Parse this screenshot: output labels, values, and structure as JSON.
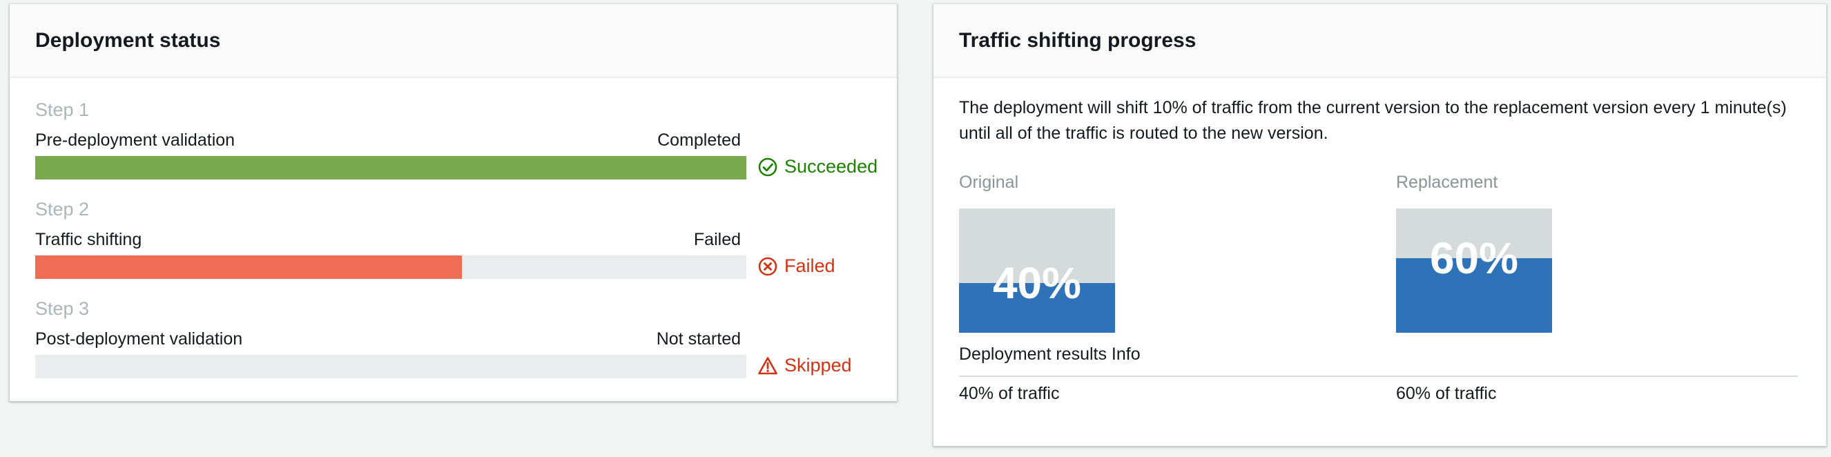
{
  "deployment": {
    "title": "Deployment status",
    "steps": [
      {
        "step": "Step 1",
        "name": "Pre-deployment validation",
        "state": "Completed",
        "progress": 1.0,
        "bar_color": "#7aa94d",
        "result": "Succeeded",
        "result_color": "#1d8102",
        "icon": "check-circle-icon"
      },
      {
        "step": "Step 2",
        "name": "Traffic shifting",
        "state": "Failed",
        "progress": 0.6,
        "bar_color": "#f06d55",
        "result": "Failed",
        "result_color": "#d13212",
        "icon": "x-circle-icon"
      },
      {
        "step": "Step 3",
        "name": "Post-deployment validation",
        "state": "Not started",
        "progress": 0.0,
        "bar_color": "#eaeded",
        "result": "Skipped",
        "result_color": "#d13212",
        "icon": "warning-icon"
      }
    ]
  },
  "traffic": {
    "title": "Traffic shifting progress",
    "description": "The deployment will shift 10% of traffic from the current version to the replacement version every 1 minute(s) until all of the traffic is routed to the new version.",
    "original": {
      "label": "Original",
      "percent_text": "40%",
      "fill": 0.4
    },
    "replacement": {
      "label": "Replacement",
      "percent_text": "60%",
      "fill": 0.6
    },
    "results_label": "Deployment results Info",
    "original_traffic": "40% of traffic",
    "replacement_traffic": "60% of traffic"
  }
}
